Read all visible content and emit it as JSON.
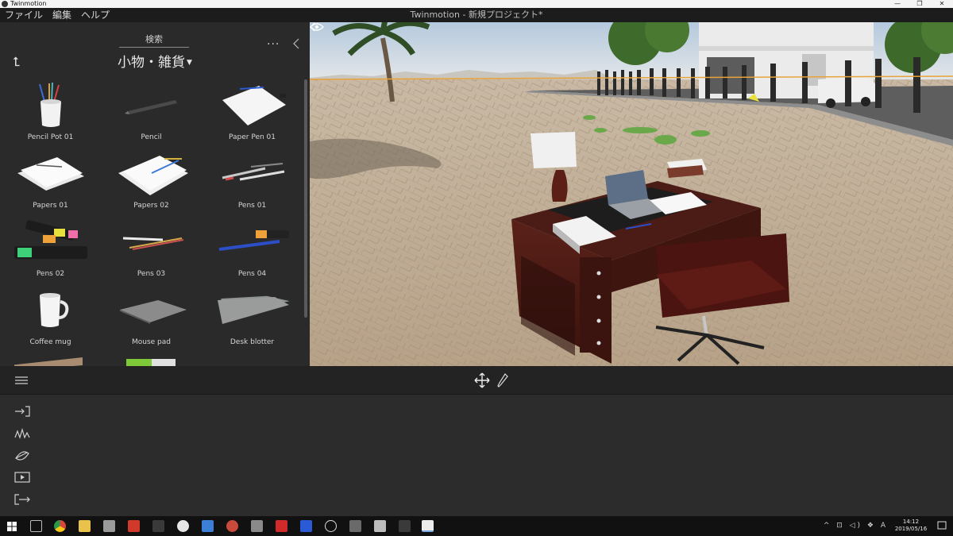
{
  "window": {
    "app_name": "Twinmotion",
    "controls": [
      "—",
      "❐",
      "✕"
    ]
  },
  "menu": {
    "items": [
      "ファイル",
      "編集",
      "ヘルプ"
    ],
    "document_title": "Twinmotion - 新規プロジェクト*"
  },
  "library": {
    "search_label": "検索",
    "category": "小物・雑貨",
    "more": "···",
    "items": [
      {
        "label": "Pencil Pot 01",
        "icon": "pencil-pot"
      },
      {
        "label": "Pencil",
        "icon": "pencil"
      },
      {
        "label": "Paper Pen 01",
        "icon": "paper-pen"
      },
      {
        "label": "Papers 01",
        "icon": "papers"
      },
      {
        "label": "Papers 02",
        "icon": "papers"
      },
      {
        "label": "Pens 01",
        "icon": "pens"
      },
      {
        "label": "Pens 02",
        "icon": "highlighters"
      },
      {
        "label": "Pens 03",
        "icon": "pens"
      },
      {
        "label": "Pens 04",
        "icon": "pens"
      },
      {
        "label": "Coffee mug",
        "icon": "mug"
      },
      {
        "label": "Mouse pad",
        "icon": "mouse-pad"
      },
      {
        "label": "Desk blotter",
        "icon": "desk-blotter"
      }
    ]
  },
  "dock": {
    "nav_icons": [
      "import-icon",
      "context-icon",
      "settings-icon",
      "media-icon",
      "export-icon"
    ]
  },
  "taskbar": {
    "time": "14:12",
    "date": "2019/05/16",
    "tray": "^ ⊡ ◁) ❖ A",
    "colors": {
      "accent": "#e8a33a"
    }
  }
}
